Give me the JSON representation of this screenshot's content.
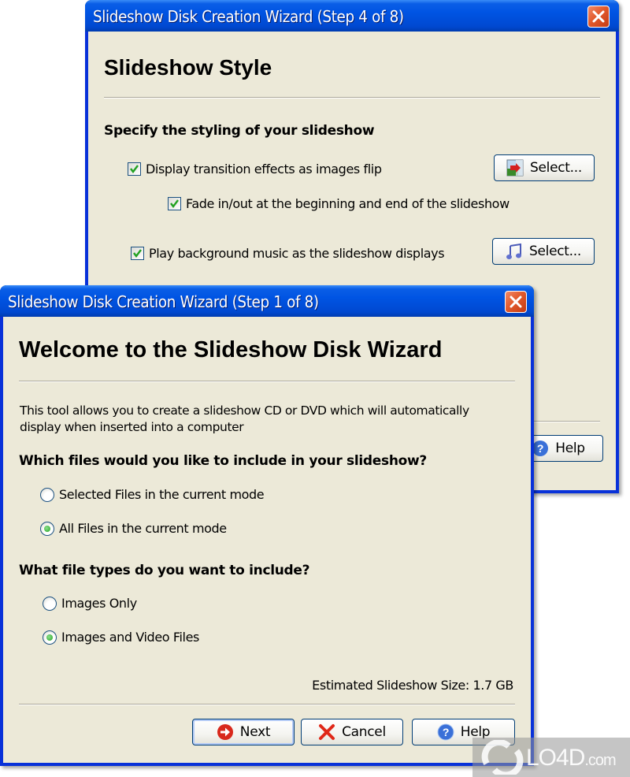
{
  "back_window": {
    "title": "Slideshow Disk Creation Wizard (Step 4 of 8)",
    "heading": "Slideshow Style",
    "section_title": "Specify the styling of your slideshow",
    "options": [
      {
        "label": "Display transition effects as images flip",
        "checked": true,
        "button_label": "Select...",
        "button_icon": "transition-image-icon"
      },
      {
        "label": "Fade in/out at the beginning and end of the slideshow",
        "checked": true
      },
      {
        "label": "Play background music as the slideshow displays",
        "checked": true,
        "button_label": "Select...",
        "button_icon": "music-note-icon"
      }
    ],
    "help_label": "Help"
  },
  "front_window": {
    "title": "Slideshow Disk Creation Wizard (Step 1 of 8)",
    "heading": "Welcome to the Slideshow Disk Wizard",
    "intro_line1": "This tool allows you to create a slideshow CD or DVD which will automatically",
    "intro_line2": "display when inserted into a computer",
    "files_question": "Which files would you like to include in your slideshow?",
    "files_options": [
      {
        "label": "Selected Files in the current mode",
        "selected": false
      },
      {
        "label": "All Files in the current mode",
        "selected": true
      }
    ],
    "types_question": "What file types do you want to include?",
    "types_options": [
      {
        "label": "Images Only",
        "selected": false
      },
      {
        "label": "Images and Video Files",
        "selected": true
      }
    ],
    "estimated_size": "Estimated Slideshow Size: 1.7 GB",
    "buttons": {
      "next": "Next",
      "cancel": "Cancel",
      "help": "Help"
    }
  },
  "watermark": {
    "text": "LO4D",
    "suffix": ".com"
  },
  "colors": {
    "titlebar_blue": "#0054e3",
    "dialog_bg": "#ece9d8",
    "close_red": "#e25a2c",
    "check_green": "#21a121"
  }
}
